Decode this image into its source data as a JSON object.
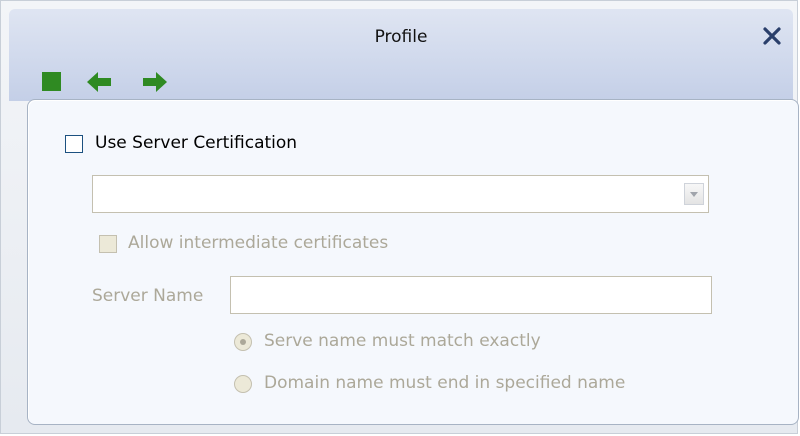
{
  "window": {
    "title": "Profile"
  },
  "toolbar": {
    "stop_icon": "square-stop-icon",
    "back_icon": "arrow-left-icon",
    "forward_icon": "arrow-right-icon",
    "close_icon": "close-x-icon",
    "icon_color": "#2f8a22"
  },
  "form": {
    "use_server_cert": {
      "label": "Use Server Certification",
      "checked": false
    },
    "certificate_select": {
      "value": ""
    },
    "allow_intermediate": {
      "label": "Allow intermediate certificates",
      "checked": false,
      "enabled": false
    },
    "server_name": {
      "label": "Server Name",
      "value": ""
    },
    "match_options": [
      {
        "label": "Serve name must match exactly",
        "selected": true,
        "enabled": false
      },
      {
        "label": "Domain name must end in specified name",
        "selected": false,
        "enabled": false
      }
    ]
  }
}
